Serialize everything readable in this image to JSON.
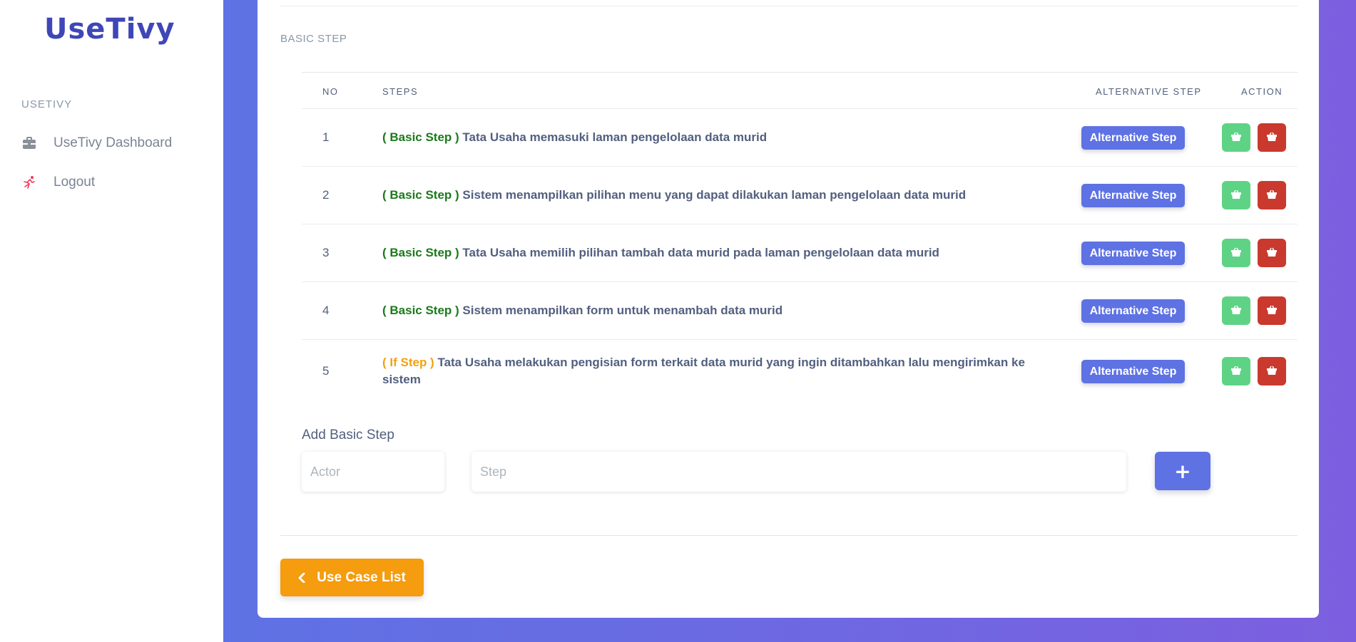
{
  "sidebar": {
    "logo": "UseTivy",
    "heading": "USETIVY",
    "items": [
      {
        "label": "UseTivy Dashboard",
        "icon": "briefcase-icon"
      },
      {
        "label": "Logout",
        "icon": "running-person-icon"
      }
    ]
  },
  "main": {
    "section_label": "BASIC STEP",
    "table": {
      "headers": {
        "no": "NO",
        "steps": "STEPS",
        "alt": "ALTERNATIVE STEP",
        "action": "ACTION"
      },
      "rows": [
        {
          "no": "1",
          "tag": "( Basic Step )",
          "text": " Tata Usaha memasuki laman pengelolaan data murid",
          "alt_label": "Alternative Step"
        },
        {
          "no": "2",
          "tag": "( Basic Step )",
          "text": " Sistem menampilkan pilihan menu yang dapat dilakukan laman pengelolaan data murid",
          "alt_label": "Alternative Step"
        },
        {
          "no": "3",
          "tag": "( Basic Step )",
          "text": " Tata Usaha memilih pilihan tambah data murid pada laman pengelolaan data murid",
          "alt_label": "Alternative Step"
        },
        {
          "no": "4",
          "tag": "( Basic Step )",
          "text": " Sistem menampilkan form untuk menambah data murid",
          "alt_label": "Alternative Step"
        },
        {
          "no": "5",
          "tag": "( If Step )",
          "text": " Tata Usaha melakukan pengisian form terkait data murid yang ingin ditambahkan lalu mengirimkan ke sistem",
          "alt_label": "Alternative Step"
        }
      ]
    },
    "add_form": {
      "label": "Add Basic Step",
      "actor_placeholder": "Actor",
      "step_placeholder": "Step",
      "add_button": "+"
    },
    "back_button": "Use Case List"
  },
  "colors": {
    "primary": "#5e72e4",
    "basic_tag": "#1b7a1b",
    "if_tag": "#f4a011",
    "success": "#5ed385",
    "danger": "#c9392e",
    "warning": "#f59c0f"
  }
}
